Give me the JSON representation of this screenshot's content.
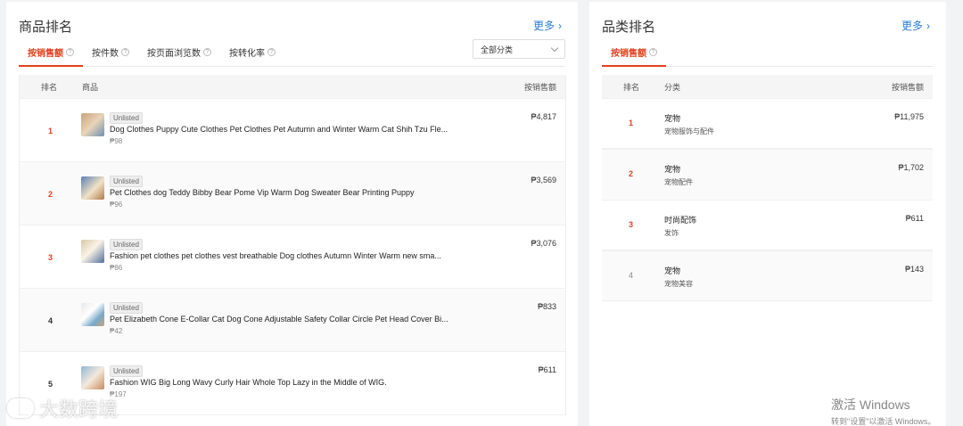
{
  "product_ranking": {
    "title": "商品排名",
    "more_label": "更多",
    "tabs": [
      {
        "label": "按销售额",
        "active": true
      },
      {
        "label": "按件数",
        "active": false
      },
      {
        "label": "按页面浏览数",
        "active": false
      },
      {
        "label": "按转化率",
        "active": false
      }
    ],
    "category_select": "全部分类",
    "columns": {
      "rank": "排名",
      "product": "商品",
      "sales": "按销售额"
    },
    "rows": [
      {
        "rank": "1",
        "status": "Unlisted",
        "name": "Dog Clothes Puppy Cute Clothes Pet Clothes Pet Autumn and Winter Warm Cat Shih Tzu Fle...",
        "price": "₱98",
        "sales": "₱4,817"
      },
      {
        "rank": "2",
        "status": "Unlisted",
        "name": "Pet Clothes dog Teddy Bibby Bear Pome Vip Warm Dog Sweater Bear Printing Puppy",
        "price": "₱96",
        "sales": "₱3,569"
      },
      {
        "rank": "3",
        "status": "Unlisted",
        "name": "Fashion pet clothes pet clothes vest breathable Dog clothes Autumn Winter Warm new sma...",
        "price": "₱86",
        "sales": "₱3,076"
      },
      {
        "rank": "4",
        "status": "Unlisted",
        "name": "Pet Elizabeth Cone E-Collar Cat Dog Cone Adjustable Safety Collar Circle Pet Head Cover Bi...",
        "price": "₱42",
        "sales": "₱833"
      },
      {
        "rank": "5",
        "status": "Unlisted",
        "name": "Fashion WIG Big Long Wavy Curly Hair Whole Top Lazy in the Middle of WIG.",
        "price": "₱197",
        "sales": "₱611"
      }
    ]
  },
  "category_ranking": {
    "title": "品类排名",
    "more_label": "更多",
    "tab": "按销售额",
    "columns": {
      "rank": "排名",
      "category": "分类",
      "sales": "按销售额"
    },
    "rows": [
      {
        "rank": "1",
        "name": "宠物",
        "sub": "宠物服饰与配件",
        "sales": "₱11,975"
      },
      {
        "rank": "2",
        "name": "宠物",
        "sub": "宠物配件",
        "sales": "₱1,702"
      },
      {
        "rank": "3",
        "name": "时尚配饰",
        "sub": "发饰",
        "sales": "₱611"
      },
      {
        "rank": "4",
        "name": "宠物",
        "sub": "宠物美容",
        "sales": "₱143"
      }
    ]
  },
  "overlay": {
    "watermark_text": "大数跨境",
    "activate_line1": "激活 Windows",
    "activate_line2": "转到\"设置\"以激活 Windows。"
  },
  "colors": {
    "accent": "#e2401c",
    "link": "#2a7bd6"
  }
}
